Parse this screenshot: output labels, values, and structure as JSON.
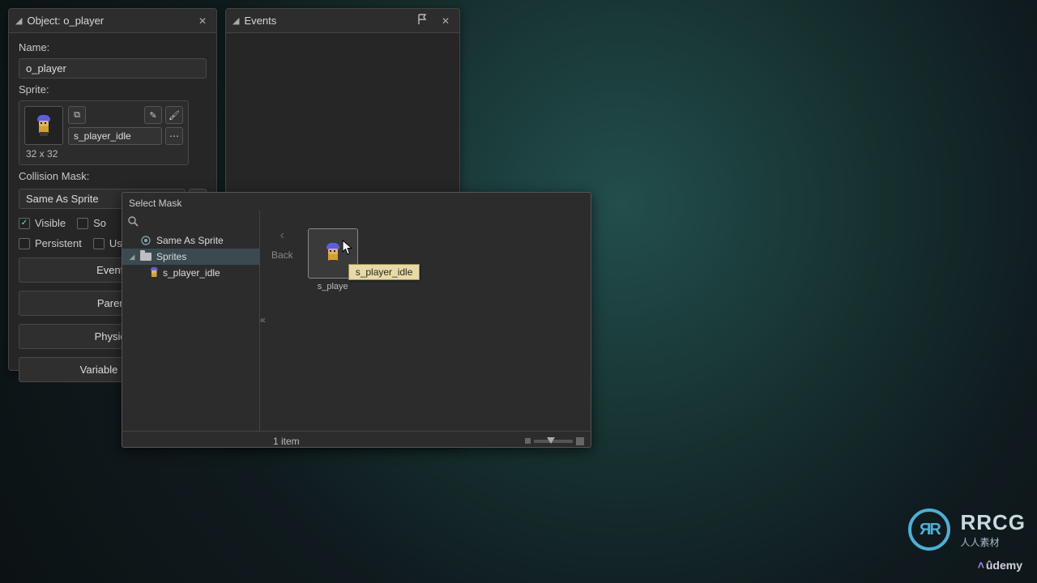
{
  "object_panel": {
    "title": "Object: o_player",
    "name_label": "Name:",
    "name_value": "o_player",
    "sprite_label": "Sprite:",
    "sprite_name": "s_player_idle",
    "sprite_dims": "32 x 32",
    "collision_label": "Collision Mask:",
    "collision_value": "Same As Sprite",
    "visible_label": "Visible",
    "visible_checked": true,
    "solid_partial": "So",
    "persistent_label": "Persistent",
    "uses_partial": "Us",
    "buttons": {
      "events": "Events",
      "parent": "Parent",
      "physics": "Physics",
      "variables": "Variable Defin"
    }
  },
  "events_panel": {
    "title": "Events"
  },
  "select_mask": {
    "title": "Select Mask",
    "tree": {
      "same_as_sprite": "Same As Sprite",
      "sprites_folder": "Sprites",
      "s_player_idle": "s_player_idle"
    },
    "back_label": "Back",
    "thumb_label_truncated": "s_playe",
    "tooltip": "s_player_idle",
    "footer_count": "1 item"
  },
  "watermark": {
    "brand": "RRCG",
    "brand_sub": "人人素材",
    "udemy": "ûdemy"
  }
}
